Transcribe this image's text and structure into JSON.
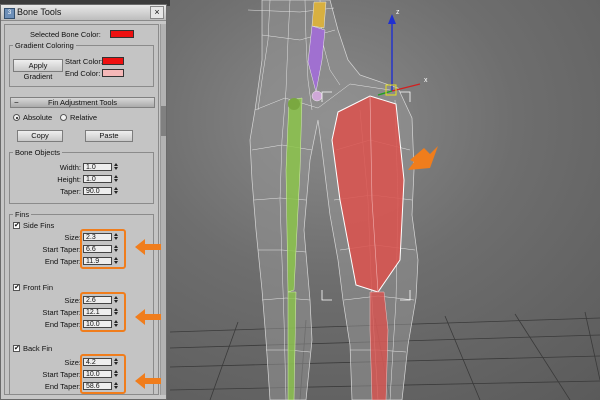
{
  "window": {
    "title": "Bone Tools",
    "close_glyph": "×"
  },
  "bone_color": {
    "label": "Selected Bone Color:",
    "color": "#ee1111"
  },
  "gradient": {
    "group_title": "Gradient Coloring",
    "apply_label": "Apply Gradient",
    "start_label": "Start Color:",
    "start_color": "#ee1111",
    "end_label": "End Color:",
    "end_color": "#f5b8b8"
  },
  "fin_adjustment": {
    "rollout_label": "Fin Adjustment Tools",
    "absolute_label": "Absolute",
    "relative_label": "Relative",
    "mode": "Absolute",
    "copy_label": "Copy",
    "paste_label": "Paste"
  },
  "bone_objects": {
    "group_title": "Bone Objects",
    "width_label": "Width:",
    "width": "1.0",
    "height_label": "Height:",
    "height": "1.0",
    "taper_label": "Taper:",
    "taper": "90.0"
  },
  "fins": {
    "group_title": "Fins",
    "size_label": "Size:",
    "start_taper_label": "Start Taper:",
    "end_taper_label": "End Taper:",
    "side": {
      "label": "Side Fins",
      "checked": true,
      "size": "2.3",
      "start_taper": "6.6",
      "end_taper": "11.9"
    },
    "front": {
      "label": "Front Fin",
      "checked": true,
      "size": "2.6",
      "start_taper": "12.1",
      "end_taper": "10.0"
    },
    "back": {
      "label": "Back Fin",
      "checked": true,
      "size": "4.2",
      "start_taper": "10.0",
      "end_taper": "58.6"
    }
  },
  "colors": {
    "highlight": "#f07d1c",
    "gizmo_x": "#d22020",
    "gizmo_y": "#20a020",
    "gizmo_z": "#2030d0",
    "gizmo_selected": "#e6e020",
    "bone_red": "#d9534f",
    "bone_green": "#8bc34a",
    "bone_purple": "#a070d0",
    "bone_yellow": "#d8b040"
  }
}
